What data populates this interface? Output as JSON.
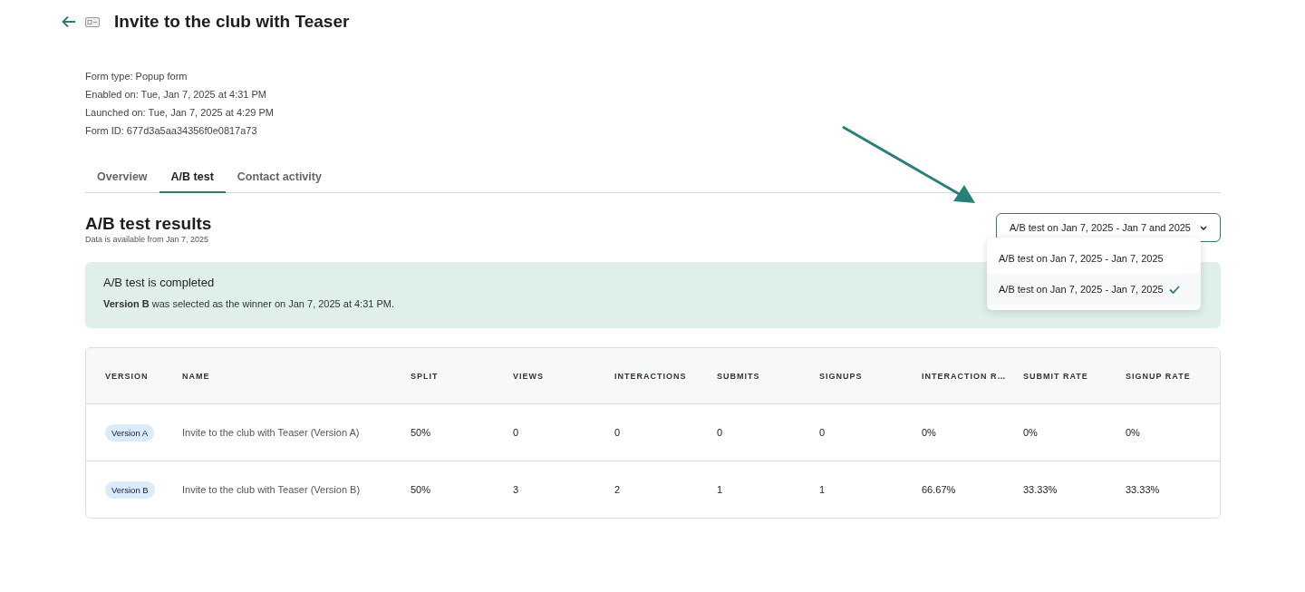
{
  "header": {
    "title": "Invite to the club with Teaser"
  },
  "meta": [
    "Form type: Popup form",
    "Enabled on: Tue, Jan 7, 2025 at 4:31 PM",
    "Launched on: Tue, Jan 7, 2025 at 4:29 PM",
    "Form ID: 677d3a5aa34356f0e0817a73"
  ],
  "tabs": [
    {
      "label": "Overview",
      "selected": false
    },
    {
      "label": "A/B test",
      "selected": true
    },
    {
      "label": "Contact activity",
      "selected": false
    }
  ],
  "results": {
    "heading": "A/B test results",
    "subtext": "Data is available from Jan 7, 2025"
  },
  "dropdown": {
    "value": "A/B test on Jan 7, 2025 - Jan 7 and 2025",
    "expanded": true,
    "options": [
      {
        "label": "A/B test on Jan 7, 2025 - Jan 7, 2025",
        "selected": false
      },
      {
        "label": "A/B test on Jan 7, 2025 - Jan 7, 2025",
        "selected": true
      }
    ]
  },
  "banner": {
    "title": "A/B test is completed",
    "message": "**Version B** was selected as the winner on Jan 7, 2025 at 4:31 PM."
  },
  "table": {
    "columns": [
      "VERSION",
      "NAME",
      "SPLIT",
      "VIEWS",
      "INTERACTIONS",
      "SUBMITS",
      "SIGNUPS",
      "INTERACTION R…",
      "SUBMIT RATE",
      "SIGNUP RATE"
    ],
    "rows": [
      {
        "cells": [
          "Version A",
          "Invite to the club with Teaser (Version A)",
          "50%",
          "0",
          "0",
          "0",
          "0",
          "0%",
          "0%",
          "0%"
        ]
      },
      {
        "cells": [
          "Version B",
          "Invite to the club with Teaser (Version B)",
          "50%",
          "3",
          "2",
          "1",
          "1",
          "66.67%",
          "33.33%",
          "33.33%"
        ]
      }
    ]
  }
}
